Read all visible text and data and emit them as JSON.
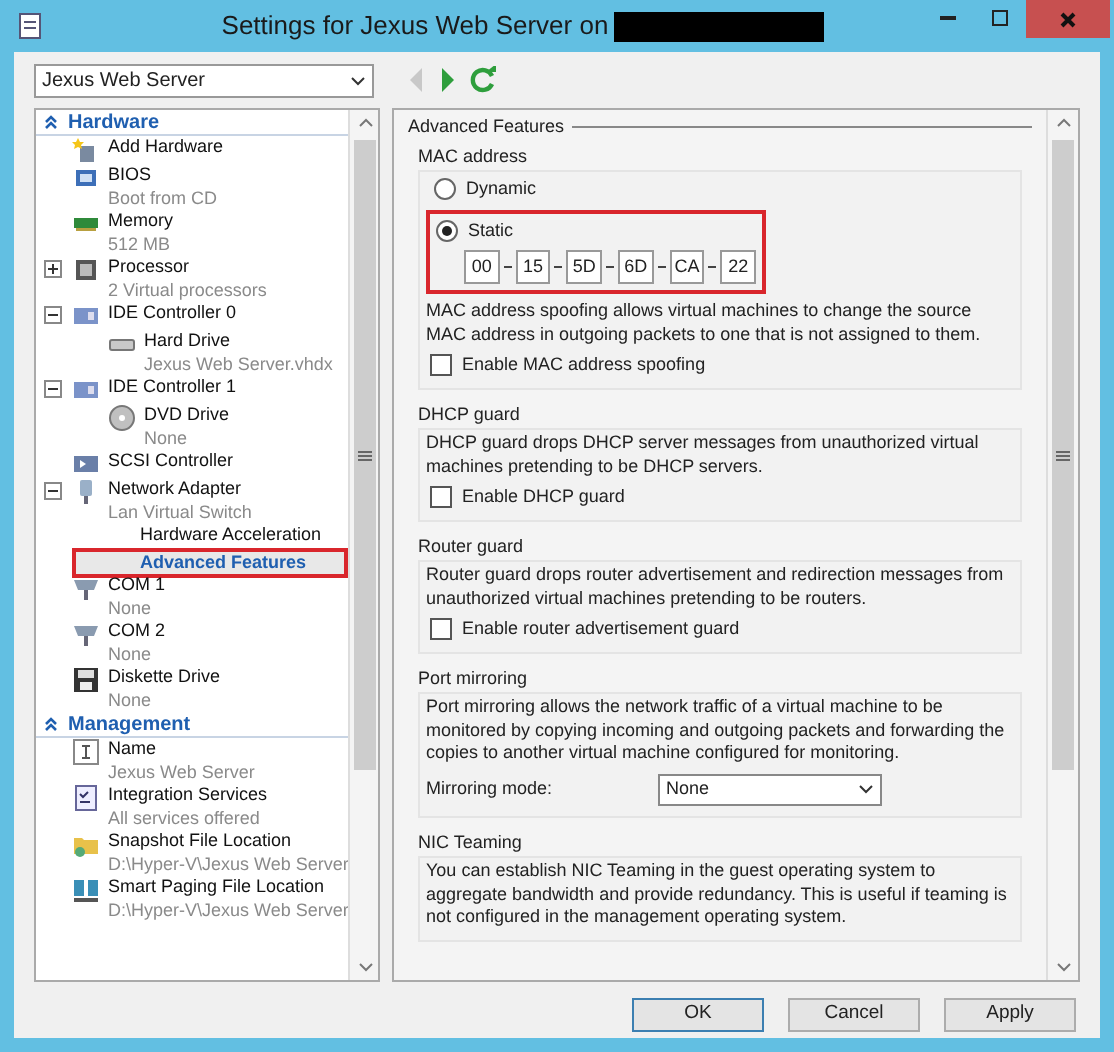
{
  "window": {
    "title": "Settings for Jexus Web Server on",
    "title_redacted": true
  },
  "vm_selector": {
    "value": "Jexus Web Server"
  },
  "nav": [
    {
      "kind": "back",
      "disabled": true
    },
    {
      "kind": "forward",
      "disabled": false
    },
    {
      "kind": "refresh",
      "disabled": false
    }
  ],
  "sidebar": {
    "sections": [
      {
        "title": "Hardware",
        "items": [
          {
            "kind": "add-hardware",
            "name": "Add Hardware",
            "selected": false
          },
          {
            "kind": "bios",
            "name": "BIOS",
            "detail": "Boot from CD",
            "selected": false
          },
          {
            "kind": "memory",
            "name": "Memory",
            "detail": "512 MB",
            "selected": false
          },
          {
            "kind": "processor",
            "name": "Processor",
            "detail": "2 Virtual processors",
            "expanded": false,
            "selected": false
          },
          {
            "kind": "controller",
            "name": "IDE Controller 0",
            "expanded": true,
            "selected": false,
            "children": [
              {
                "kind": "hard-drive",
                "name": "Hard Drive",
                "detail": "Jexus Web Server.vhdx",
                "selected": false
              }
            ]
          },
          {
            "kind": "controller",
            "name": "IDE Controller 1",
            "expanded": true,
            "selected": false,
            "children": [
              {
                "kind": "dvd-drive",
                "name": "DVD Drive",
                "detail": "None",
                "selected": false
              }
            ]
          },
          {
            "kind": "scsi",
            "name": "SCSI Controller",
            "selected": false
          },
          {
            "kind": "network-adapter",
            "name": "Network Adapter",
            "detail": "Lan Virtual Switch",
            "expanded": true,
            "selected": false,
            "children": [
              {
                "kind": "subpage",
                "name": "Hardware Acceleration",
                "selected": false,
                "highlighted": false
              },
              {
                "kind": "subpage",
                "name": "Advanced Features",
                "selected": true,
                "highlighted": true
              }
            ]
          },
          {
            "kind": "com-port",
            "name": "COM 1",
            "detail": "None",
            "selected": false
          },
          {
            "kind": "com-port",
            "name": "COM 2",
            "detail": "None",
            "selected": false
          },
          {
            "kind": "diskette",
            "name": "Diskette Drive",
            "detail": "None",
            "selected": false
          }
        ]
      },
      {
        "title": "Management",
        "items": [
          {
            "kind": "name",
            "name": "Name",
            "detail": "Jexus Web Server",
            "selected": false
          },
          {
            "kind": "integration",
            "name": "Integration Services",
            "detail": "All services offered",
            "selected": false
          },
          {
            "kind": "snapshot",
            "name": "Snapshot File Location",
            "detail": "D:\\Hyper-V\\Jexus Web Server",
            "selected": false
          },
          {
            "kind": "paging",
            "name": "Smart Paging File Location",
            "detail": "D:\\Hyper-V\\Jexus Web Server",
            "selected": false
          }
        ]
      }
    ]
  },
  "panel": {
    "title": "Advanced Features",
    "groups": [
      {
        "kind": "mac",
        "title": "MAC address",
        "options": [
          {
            "label": "Dynamic",
            "selected": false
          },
          {
            "label": "Static",
            "selected": true
          }
        ],
        "highlighted": true,
        "mac_octets": [
          "00",
          "15",
          "5D",
          "6D",
          "CA",
          "22"
        ],
        "description": "MAC address spoofing allows virtual machines to change the source MAC address in outgoing packets to one that is not assigned to them.",
        "checkbox": {
          "label": "Enable MAC address spoofing",
          "checked": false
        }
      },
      {
        "kind": "check",
        "title": "DHCP guard",
        "description": "DHCP guard drops DHCP server messages from unauthorized virtual machines pretending to be DHCP servers.",
        "checkbox": {
          "label": "Enable DHCP guard",
          "checked": false
        }
      },
      {
        "kind": "check",
        "title": "Router guard",
        "description": "Router guard drops router advertisement and redirection messages from unauthorized virtual machines pretending to be routers.",
        "checkbox": {
          "label": "Enable router advertisement guard",
          "checked": false
        }
      },
      {
        "kind": "select",
        "title": "Port mirroring",
        "description": "Port mirroring allows the network traffic of a virtual machine to be monitored by copying incoming and outgoing packets and forwarding the copies to another virtual machine configured for monitoring.",
        "select": {
          "label": "Mirroring mode:",
          "value": "None"
        }
      },
      {
        "kind": "text",
        "title": "NIC Teaming",
        "description": "You can establish NIC Teaming in the guest operating system to aggregate bandwidth and provide redundancy. This is useful if teaming is not configured in the management operating system."
      }
    ]
  },
  "buttons": [
    {
      "label": "OK",
      "default": true
    },
    {
      "label": "Cancel",
      "default": false
    },
    {
      "label": "Apply",
      "default": false
    }
  ]
}
